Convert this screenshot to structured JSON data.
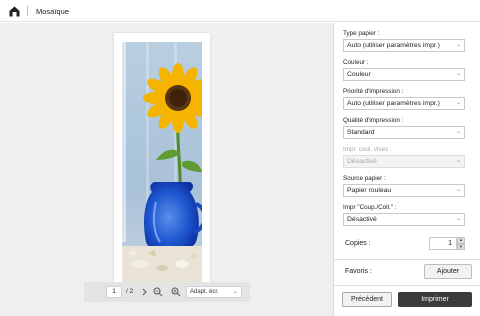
{
  "window": {
    "title": "Mosaïque"
  },
  "preview": {
    "page_current": "1",
    "page_total": "/ 2",
    "zoom_value": "Adapt. écr."
  },
  "panel": {
    "fields": [
      {
        "label": "Type papier :",
        "value": "Auto (utiliser paramètres impr.)",
        "disabled": false
      },
      {
        "label": "Couleur :",
        "value": "Couleur",
        "disabled": false
      },
      {
        "label": "Priorité d'impression :",
        "value": "Auto (utiliser paramètres impr.)",
        "disabled": false
      },
      {
        "label": "Qualité d'impression :",
        "value": "Standard",
        "disabled": false
      },
      {
        "label": "Impr. coul. vives :",
        "value": "Désactivé",
        "disabled": true
      },
      {
        "label": "Source papier :",
        "value": "Papier rouleau",
        "disabled": false
      },
      {
        "label": "Impr \"Coup./Coll.\" :",
        "value": "Désactivé",
        "disabled": false
      }
    ],
    "copies_label": "Copies :",
    "copies_value": "1",
    "favorites_label": "Favoris :",
    "add_button": "Ajouter",
    "previous_button": "Précédent",
    "print_button": "Imprimer"
  },
  "icons": {
    "home": "home-icon",
    "prev_page": "chevron-left-icon",
    "next_page": "chevron-right-icon",
    "zoom_out": "zoom-out-icon",
    "zoom_in": "zoom-in-icon",
    "dropdown": "chevron-down-icon"
  },
  "colors": {
    "print_button_bg": "#3b3b3b",
    "preview_bg": "#efefef",
    "disabled_text": "#a8a8a8"
  }
}
